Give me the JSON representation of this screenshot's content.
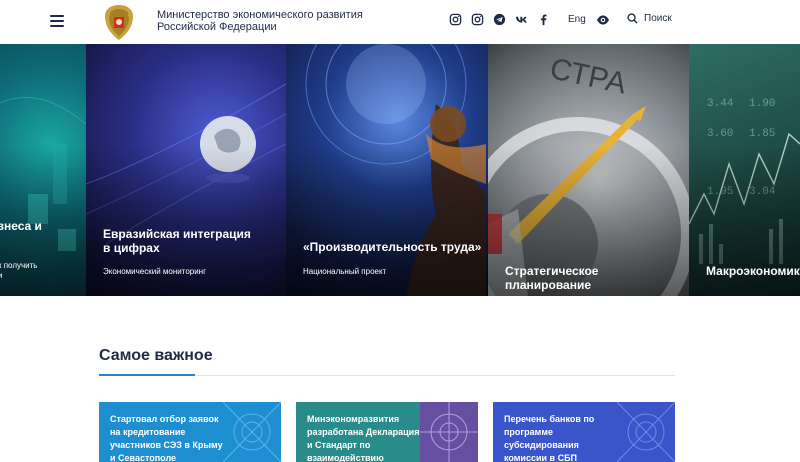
{
  "header": {
    "ministry_line1": "Министерство экономического развития",
    "ministry_line2": "Российской Федерации",
    "lang_label": "Eng",
    "search_label": "Поиск",
    "icons": [
      "menu-icon",
      "emblem",
      "instagram-icon",
      "instagram-icon",
      "telegram-icon",
      "vk-icon",
      "facebook-icon",
      "eye-icon",
      "search-icon"
    ]
  },
  "slides": [
    {
      "title": "знеса и",
      "subtitle": "к получить\nи"
    },
    {
      "title": "Евразийская интеграция в цифрах",
      "subtitle": "Экономический мониторинг"
    },
    {
      "title": "«Производительность труда»",
      "subtitle": "Национальный проект"
    },
    {
      "title": "Стратегическое планирование",
      "subtitle": ""
    },
    {
      "title": "Макроэкономика",
      "subtitle": ""
    }
  ],
  "section": {
    "title": "Самое важное"
  },
  "cards": [
    {
      "text": "Стартовал отбор заявок на кредитование участников СЭЗ в Крыму и Севастополе"
    },
    {
      "text": "Минэкономразвития разработана Декларация и Стандарт по взаимодействию"
    },
    {
      "text": "Перечень банков по программе субсидирования комиссии в СБП"
    }
  ],
  "colors": {
    "text_dark": "#1f2a44",
    "accent_blue": "#2f7fd6",
    "card1": "#1d8fd1",
    "card2": "#2a8c8a",
    "card3": "#3a55c9"
  }
}
